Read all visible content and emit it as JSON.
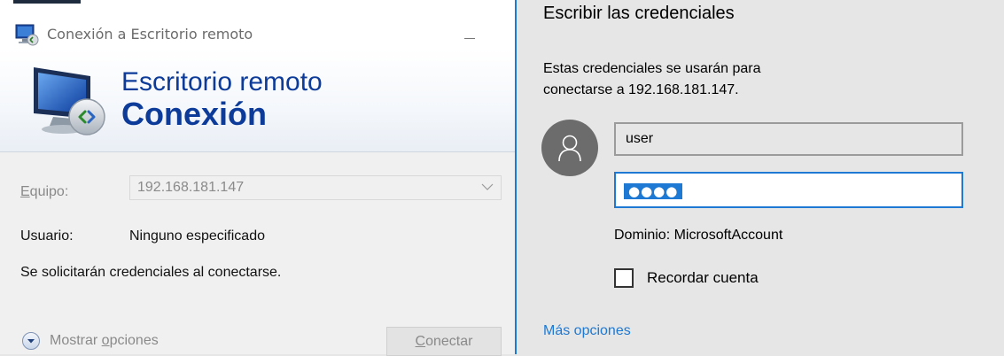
{
  "rdc_window": {
    "title": "Conexión a Escritorio remoto",
    "banner": {
      "line1": "Escritorio remoto",
      "line2": "Conexión"
    },
    "computer": {
      "label_underlined": "E",
      "label_rest": "quipo:",
      "value": "192.168.181.147"
    },
    "user": {
      "label": "Usuario:",
      "value": "Ninguno especificado"
    },
    "note": "Se solicitarán credenciales al conectarse.",
    "options_button": {
      "prefix": "Mostrar ",
      "underlined": "o",
      "rest": "pciones"
    },
    "connect_button": {
      "underlined": "C",
      "rest": "onectar"
    },
    "icons": [
      "rdc-app-icon",
      "remote-desktop-monitor-icon",
      "chevron-down-icon",
      "expand-circle-icon"
    ]
  },
  "credentials": {
    "heading": "Escribir las credenciales",
    "description": "Estas credenciales se usarán para conectarse a 192.168.181.147.",
    "username": "user",
    "password_mask": "●●●●",
    "domain": "Dominio: MicrosoftAccount",
    "remember_label": "Recordar cuenta",
    "remember_checked": false,
    "more_options": "Más opciones",
    "icons": [
      "user-avatar-icon"
    ]
  },
  "colors": {
    "accent": "#1d79d4",
    "banner_text": "#0c3b9a",
    "panel_bg": "#e6e6e6"
  }
}
